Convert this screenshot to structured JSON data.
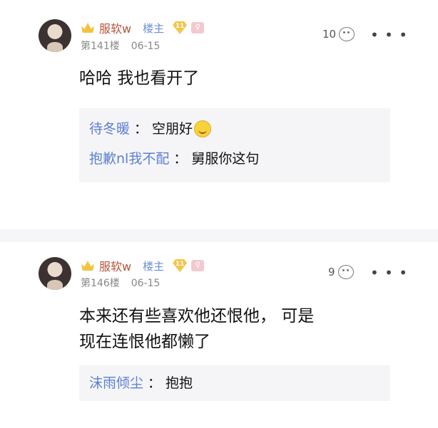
{
  "posts": [
    {
      "username": "服软w",
      "badge_lz": "楼主",
      "level": "11",
      "floor": "第141楼",
      "date": "06-15",
      "likes": "10",
      "content": "哈哈 我也看开了",
      "replies": [
        {
          "name": "待冬暖",
          "text": "空朋好",
          "icon": "smile-icon"
        },
        {
          "name": "抱歉nl我不配",
          "text": "舅服你这句"
        }
      ]
    },
    {
      "username": "服软w",
      "badge_lz": "楼主",
      "level": "11",
      "floor": "第146楼",
      "date": "06-15",
      "likes": "9",
      "content_line1": "本来还有些喜欢他还恨他， 可是",
      "content_line2": "现在连恨他都懒了",
      "replies": [
        {
          "name": "沫雨倾尘",
          "text": "抱抱"
        }
      ]
    }
  ],
  "ui": {
    "colon": "：",
    "more": "• • •"
  },
  "colors": {
    "username": "#b8543a",
    "lz": "#6b8fd6",
    "reply_name": "#5b7fd0",
    "reply_bg": "#f5f5f8"
  }
}
